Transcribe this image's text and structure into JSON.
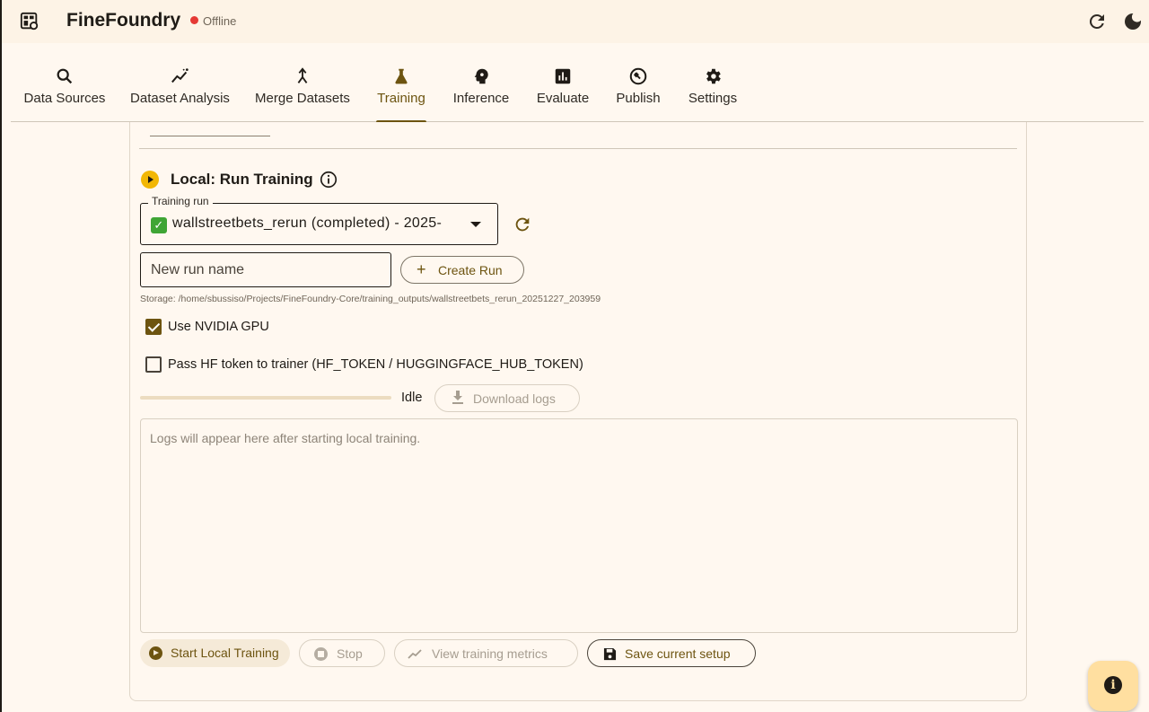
{
  "app": {
    "title": "FineFoundry",
    "status": "Offline",
    "status_color": "#e53935",
    "icons": {
      "logo": "dashboard-icon",
      "refresh": "refresh-icon",
      "theme": "dark-mode-icon"
    }
  },
  "tabs": [
    {
      "label": "Data Sources",
      "icon": "search-icon",
      "active": false
    },
    {
      "label": "Dataset Analysis",
      "icon": "insights-icon",
      "active": false
    },
    {
      "label": "Merge Datasets",
      "icon": "merge-icon",
      "active": false
    },
    {
      "label": "Training",
      "icon": "flask-icon",
      "active": true
    },
    {
      "label": "Inference",
      "icon": "psychology-icon",
      "active": false
    },
    {
      "label": "Evaluate",
      "icon": "chart-icon",
      "active": false
    },
    {
      "label": "Publish",
      "icon": "build-circle-icon",
      "active": false
    },
    {
      "label": "Settings",
      "icon": "gear-icon",
      "active": false
    }
  ],
  "section": {
    "title": "Local: Run Training"
  },
  "training_run": {
    "label": "Training run",
    "selected": "wallstreetbets_rerun (completed) - 2025-"
  },
  "new_run": {
    "placeholder": "New run name",
    "create_label": "Create Run"
  },
  "storage": "Storage: /home/sbussiso/Projects/FineFoundry-Core/training_outputs/wallstreetbets_rerun_20251227_203959",
  "options": {
    "gpu": {
      "label": "Use NVIDIA GPU",
      "checked": true
    },
    "hf_token": {
      "label": "Pass HF token to trainer (HF_TOKEN / HUGGINGFACE_HUB_TOKEN)",
      "checked": false
    }
  },
  "progress": {
    "value": 0,
    "status": "Idle",
    "download_label": "Download logs"
  },
  "logs": {
    "placeholder": "Logs will appear here after starting local training."
  },
  "actions": {
    "start": "Start Local Training",
    "stop": "Stop",
    "metrics": "View training metrics",
    "save": "Save current setup"
  },
  "colors": {
    "accent": "#6d5410",
    "background": "#fff8f0",
    "section_icon": "#f2b705",
    "fab": "#ffdfa0"
  }
}
